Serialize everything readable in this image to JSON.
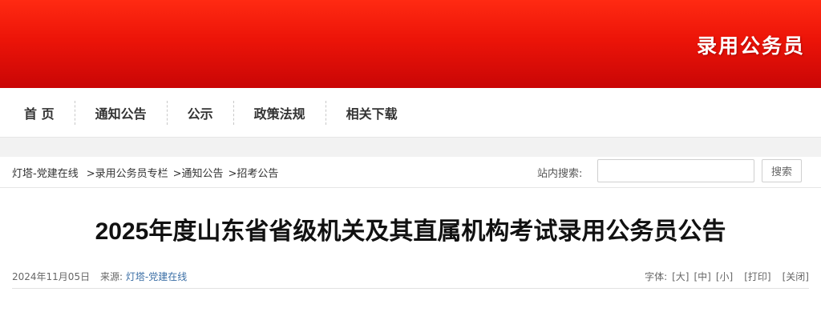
{
  "banner": {
    "title": "录用公务员"
  },
  "nav": {
    "items": [
      {
        "label": "首 页"
      },
      {
        "label": "通知公告"
      },
      {
        "label": "公示"
      },
      {
        "label": "政策法规"
      },
      {
        "label": "相关下载"
      }
    ]
  },
  "breadcrumb": {
    "items": [
      {
        "label": "灯塔-党建在线"
      },
      {
        "label": ">录用公务员专栏"
      },
      {
        "label": ">通知公告"
      },
      {
        "label": ">招考公告"
      }
    ]
  },
  "search": {
    "label": "站内搜索:",
    "placeholder": "",
    "value": "",
    "button_label": "搜索"
  },
  "article": {
    "title": "2025年度山东省省级机关及其直属机构考试录用公务员公告",
    "date": "2024年11月05日",
    "source_label": "来源:",
    "source_value": "灯塔-党建在线",
    "font_label": "字体:",
    "font_large": "[大]",
    "font_medium": "[中]",
    "font_small": "[小]",
    "print_label": "[打印]",
    "close_label": "[关闭]"
  },
  "colors": {
    "banner_top": "#ff2a12",
    "banner_bottom": "#c90606",
    "link": "#3a6ea5"
  }
}
